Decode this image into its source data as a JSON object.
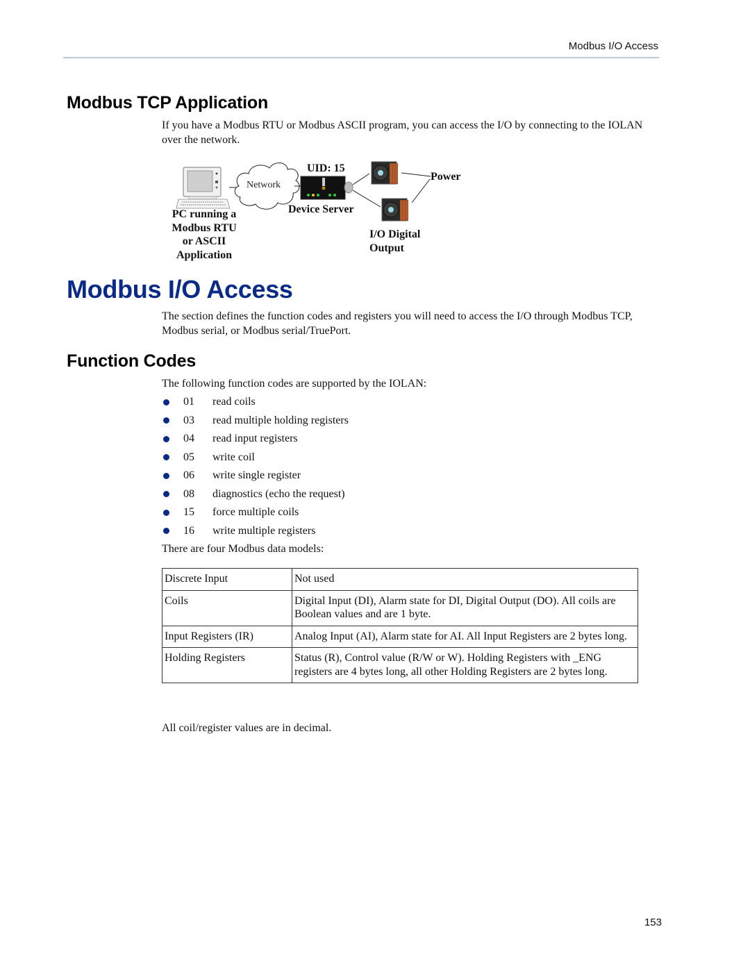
{
  "header": {
    "running_title": "Modbus I/O Access"
  },
  "section_tcp": {
    "heading": "Modbus TCP Application",
    "intro": "If you have a Modbus RTU or Modbus ASCII program, you can access the I/O by connecting to the IOLAN over the network."
  },
  "diagram": {
    "pc_label_lines": [
      "PC running a",
      "Modbus RTU",
      "or ASCII",
      "Application"
    ],
    "network_label": "Network",
    "uid_label": "UID: 15",
    "device_server_label": "Device Server",
    "power_label": "Power",
    "io_label_lines": [
      "I/O Digital",
      "Output"
    ],
    "icons": [
      "computer-icon",
      "network-cloud-icon",
      "device-server-icon",
      "io-module-icon",
      "io-module-icon"
    ]
  },
  "section_io": {
    "heading": "Modbus I/O Access",
    "intro": "The section defines the function codes and registers you will need to access the I/O through Modbus TCP, Modbus serial, or Modbus serial/TruePort."
  },
  "section_fc": {
    "heading": "Function Codes",
    "intro": "The following function codes are supported by the IOLAN:",
    "codes": [
      {
        "code": "01",
        "desc": "read coils"
      },
      {
        "code": "03",
        "desc": "read multiple holding registers"
      },
      {
        "code": "04",
        "desc": "read input registers"
      },
      {
        "code": "05",
        "desc": "write coil"
      },
      {
        "code": "06",
        "desc": "write single register"
      },
      {
        "code": "08",
        "desc": "diagnostics (echo the request)"
      },
      {
        "code": "15",
        "desc": "force multiple coils"
      },
      {
        "code": "16",
        "desc": "write multiple registers"
      }
    ],
    "models_intro": "There are four Modbus data models:",
    "models": [
      {
        "name": "Discrete Input",
        "desc": "Not used"
      },
      {
        "name": "Coils",
        "desc": "Digital Input (DI), Alarm state for DI, Digital Output (DO). All coils are Boolean values and are 1 byte."
      },
      {
        "name": "Input Registers (IR)",
        "desc": "Analog Input (AI), Alarm state for AI. All Input Registers are 2 bytes long."
      },
      {
        "name": "Holding Registers",
        "desc": "Status (R), Control value (R/W or W). Holding Registers with _ENG registers are 4 bytes long, all other Holding Registers are 2 bytes long."
      }
    ],
    "footer_note": "All coil/register values are in decimal."
  },
  "colors": {
    "heading_blue": "#0a2a87",
    "bullet_blue": "#0a2a87",
    "header_rule": "#b9c9da"
  },
  "footer": {
    "page_number": "153"
  }
}
